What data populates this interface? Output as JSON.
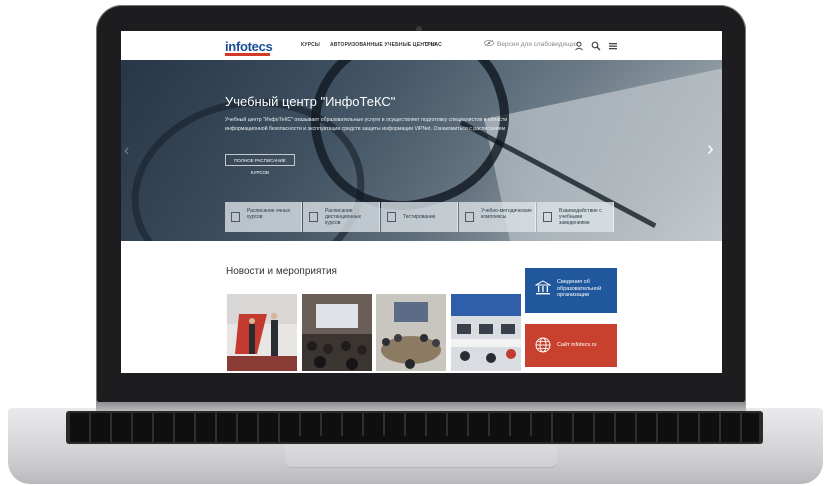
{
  "header": {
    "logo_text": "infotecs",
    "nav": [
      "КУРСЫ",
      "АВТОРИЗОВАННЫЕ УЧЕБНЫЕ ЦЕНТРЫ",
      "О НАС"
    ],
    "vision_label": "Версия для слабовидящих"
  },
  "hero": {
    "title": "Учебный центр \"ИнфоТеКС\"",
    "text": "Учебный центр \"ИнфоТеКС\" оказывает образовательные услуги и осуществляет подготовку специалистов в области информационной безопасности и эксплуатации средств защиты информации ViPNet. Ознакомиться с расписанием",
    "button_label": "ПОЛНОЕ РАСПИСАНИЕ КУРСОВ",
    "tiles": [
      {
        "label": "Расписание очных курсов",
        "icon": "document-icon"
      },
      {
        "label": "Расписание дистанционных курсов",
        "icon": "monitor-icon"
      },
      {
        "label": "Тестирование",
        "icon": "book-icon"
      },
      {
        "label": "Учебно-методические комплексы",
        "icon": "methods-icon"
      },
      {
        "label": "Взаимодействие с учебными заведениями",
        "icon": "cooperation-icon"
      }
    ]
  },
  "news": {
    "title": "Новости и мероприятия"
  },
  "side_boxes": {
    "info_label": "Сведения об образовательной организации",
    "site_label": "Сайт infotecs.ru"
  },
  "colors": {
    "brand_blue": "#21579c",
    "brand_red": "#c8402e",
    "logo_blue": "#1b4f95"
  }
}
